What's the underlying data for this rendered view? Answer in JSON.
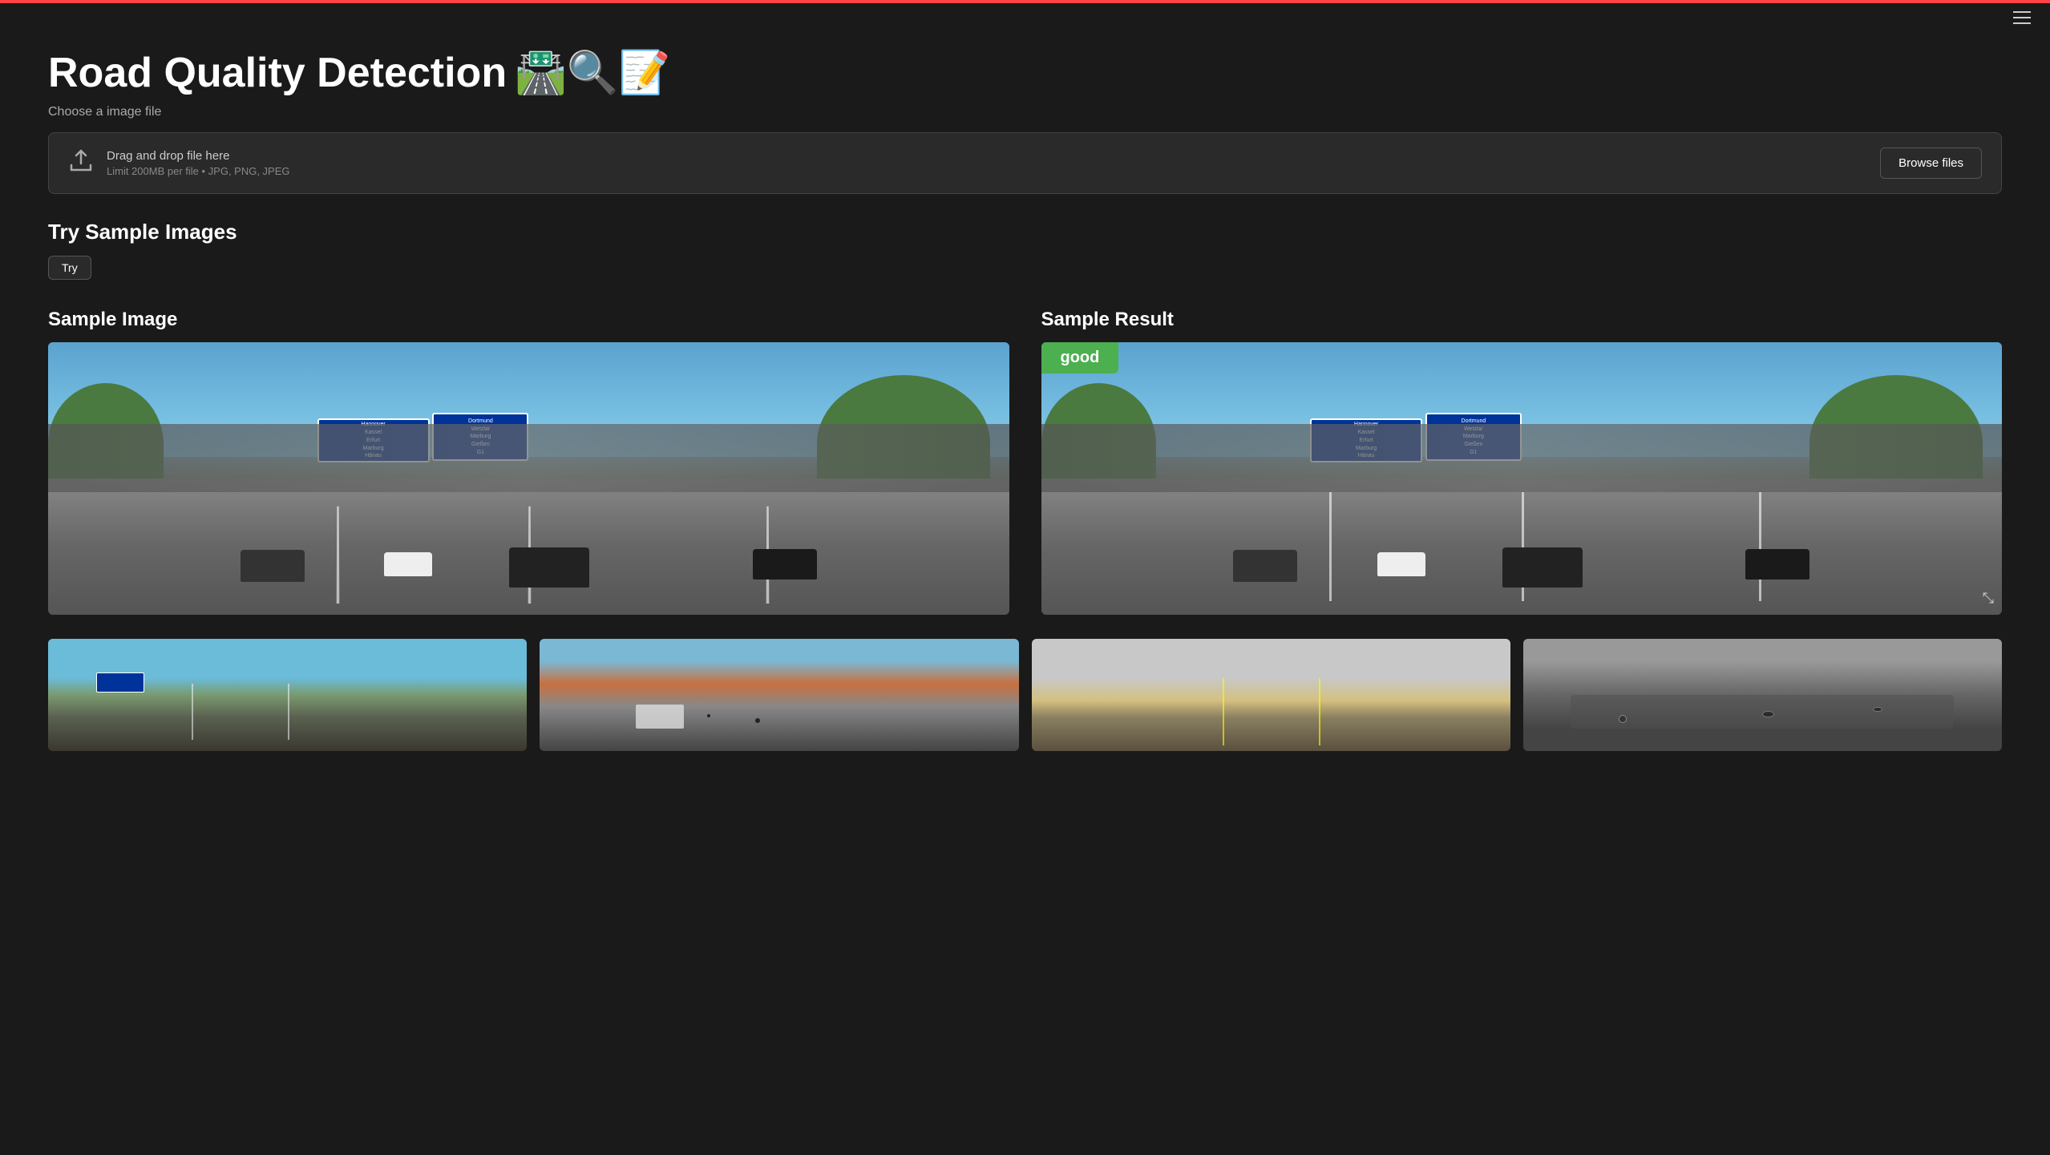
{
  "app": {
    "top_bar_color": "#ff4444",
    "bg_color": "#1a1a1a"
  },
  "header": {
    "hamburger_lines": 3
  },
  "page": {
    "title": "Road Quality Detection",
    "title_emojis": "🛣️🔍📝",
    "subtitle": "Choose a image file",
    "upload": {
      "drag_drop_text": "Drag and drop file here",
      "limit_text": "Limit 200MB per file • JPG, PNG, JPEG",
      "browse_label": "Browse files"
    },
    "sample_section": {
      "title": "Try Sample Images",
      "try_button_label": "Try"
    },
    "sample_image": {
      "section_title": "Sample Image"
    },
    "sample_result": {
      "section_title": "Sample Result",
      "badge_text": "good",
      "badge_color": "#4caf50"
    }
  }
}
